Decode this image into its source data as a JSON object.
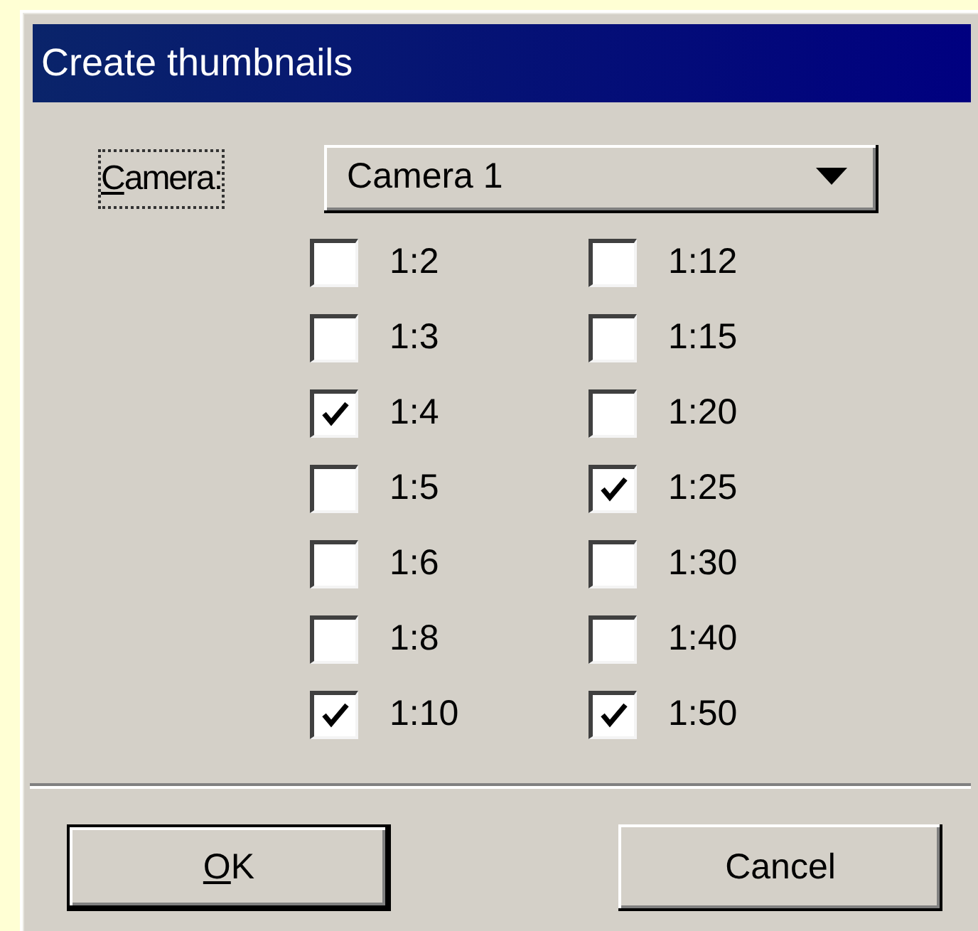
{
  "window": {
    "title": "Create thumbnails"
  },
  "camera": {
    "label": "Camera:",
    "first_letter_underlined": true,
    "focused": true,
    "value": "Camera 1"
  },
  "columns": [
    [
      {
        "label": "1:2",
        "checked": false
      },
      {
        "label": "1:3",
        "checked": false
      },
      {
        "label": "1:4",
        "checked": true
      },
      {
        "label": "1:5",
        "checked": false
      },
      {
        "label": "1:6",
        "checked": false
      },
      {
        "label": "1:8",
        "checked": false
      },
      {
        "label": "1:10",
        "checked": true
      }
    ],
    [
      {
        "label": "1:12",
        "checked": false
      },
      {
        "label": "1:15",
        "checked": false
      },
      {
        "label": "1:20",
        "checked": false
      },
      {
        "label": "1:25",
        "checked": true
      },
      {
        "label": "1:30",
        "checked": false
      },
      {
        "label": "1:40",
        "checked": false
      },
      {
        "label": "1:50",
        "checked": true
      }
    ]
  ],
  "buttons": [
    {
      "label": "OK",
      "first_letter_underlined": true,
      "default": true
    },
    {
      "label": "Cancel",
      "default": false
    }
  ]
}
